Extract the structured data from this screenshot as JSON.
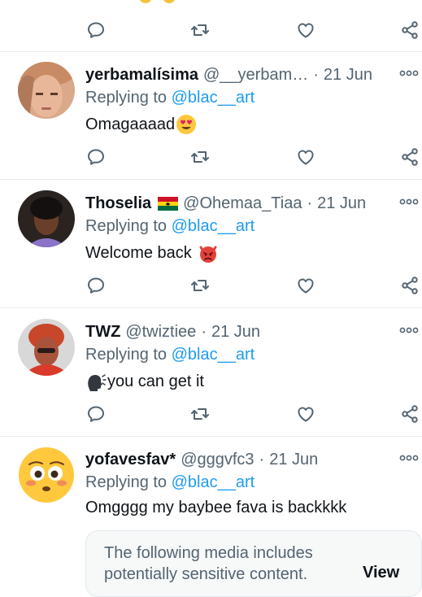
{
  "tweets": [
    {
      "name": "yerbamalísima",
      "handle": "@__yerbam…",
      "time": "21 Jun",
      "replying_prefix": "Replying to",
      "replying_to": "@blac__art",
      "text": "Omagaaaad",
      "emoji": "heart-eyes-face"
    },
    {
      "name": "Thoselia",
      "flag": "ghana-flag",
      "handle": "@Ohemaa_Tiaa",
      "time": "21 Jun",
      "replying_prefix": "Replying to",
      "replying_to": "@blac__art",
      "text": "Welcome back",
      "emoji": "red-devil-face"
    },
    {
      "name": "TWZ",
      "handle": "@twiztiee",
      "time": "21 Jun",
      "replying_prefix": "Replying to",
      "replying_to": "@blac__art",
      "text": "you can get it",
      "emoji": "speaking-head"
    },
    {
      "name": "yofavesfav*",
      "handle": "@gggvfc3",
      "time": "21 Jun",
      "replying_prefix": "Replying to",
      "replying_to": "@blac__art",
      "text": "Omgggg my baybee fava is backkkk"
    }
  ],
  "sensitive_notice": {
    "message": "The following media includes potentially sensitive content.",
    "action": "View"
  },
  "icons": [
    "reply-icon",
    "retweet-icon",
    "like-icon",
    "share-icon",
    "more-icon"
  ],
  "colors": {
    "text": "#0f1419",
    "secondary": "#536471",
    "link": "#1d9bf0",
    "divider": "#e6ecf0"
  }
}
